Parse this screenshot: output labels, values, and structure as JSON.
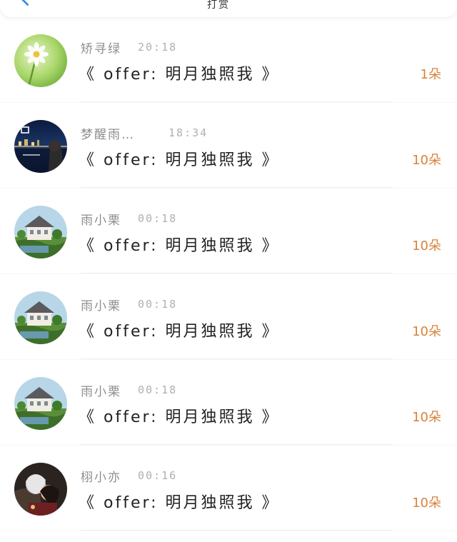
{
  "header": {
    "title_fragment": "打赏"
  },
  "colors": {
    "accent_back": "#3a8ee6",
    "count_orange": "#d9823a"
  },
  "rows": [
    {
      "name": "矫寻绿",
      "time": "20:18",
      "book": "《 offer: 明月独照我 》",
      "count": "1朵",
      "avatar": "flower-avatar"
    },
    {
      "name": "梦醒雨…",
      "time": "18:34",
      "book": "《 offer: 明月独照我 》",
      "count": "10朵",
      "avatar": "night-city-avatar"
    },
    {
      "name": "雨小栗",
      "time": "00:18",
      "book": "《 offer: 明月独照我 》",
      "count": "10朵",
      "avatar": "house-avatar"
    },
    {
      "name": "雨小栗",
      "time": "00:18",
      "book": "《 offer: 明月独照我 》",
      "count": "10朵",
      "avatar": "house-avatar"
    },
    {
      "name": "雨小栗",
      "time": "00:18",
      "book": "《 offer: 明月独照我 》",
      "count": "10朵",
      "avatar": "house-avatar"
    },
    {
      "name": "栩小亦",
      "time": "00:16",
      "book": "《 offer: 明月独照我 》",
      "count": "10朵",
      "avatar": "couple-avatar"
    }
  ]
}
